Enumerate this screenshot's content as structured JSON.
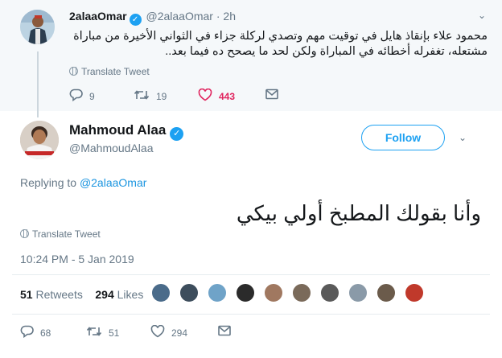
{
  "parent_tweet": {
    "display_name": "2alaaOmar",
    "handle": "@2alaaOmar",
    "time_ago": "· 2h",
    "text": "محمود علاء بإنقاذ هايل في توقيت مهم وتصدي لركلة جزاء في الثواني الأخيرة من مباراة مشتعله، تغفرله أخطائه في المباراة ولكن لحد ما يصحح ده فيما بعد..",
    "translate_label": "Translate Tweet",
    "reply_count": "9",
    "retweet_count": "19",
    "like_count": "443"
  },
  "main_tweet": {
    "display_name": "Mahmoud Alaa",
    "handle": "@MahmoudAlaa",
    "follow_label": "Follow",
    "replying_prefix": "Replying to",
    "replying_to": "@2alaaOmar",
    "text": "وأنا بقولك المطبخ أولي بيكي",
    "translate_label": "Translate Tweet",
    "timestamp": "10:24 PM - 5 Jan 2019",
    "retweets_count": "51",
    "retweets_label": "Retweets",
    "likes_count": "294",
    "likes_label": "Likes",
    "reply_count": "68",
    "retweet_count": "51",
    "like_count": "294"
  },
  "icons": {
    "verified": "verified-badge-icon",
    "caret": "chevron-down-icon",
    "reply": "reply-icon",
    "retweet": "retweet-icon",
    "like": "heart-icon",
    "dm": "envelope-icon",
    "translate": "globe-icon"
  },
  "colors": {
    "accent": "#1da1f2",
    "link": "#1b95e0",
    "like": "#e0245e",
    "muted": "#657786",
    "parent_bg": "#f5f8fa"
  }
}
